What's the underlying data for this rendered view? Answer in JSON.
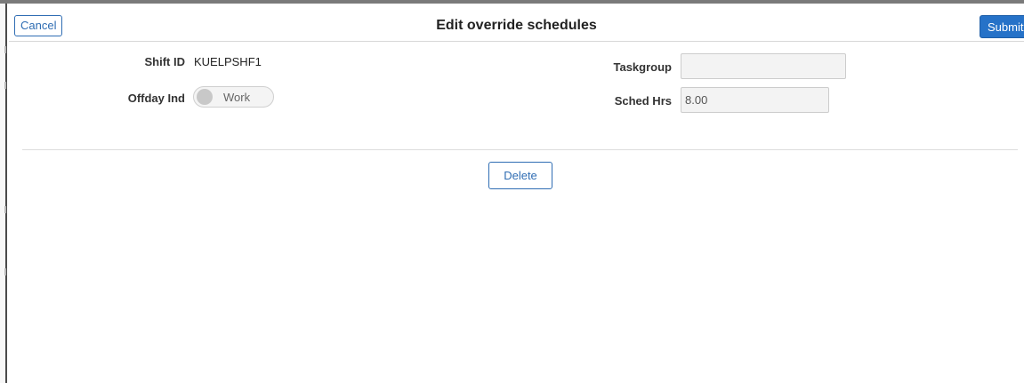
{
  "header": {
    "title": "Edit override schedules",
    "cancel_label": "Cancel",
    "submit_label": "Submit"
  },
  "form": {
    "shift_id_label": "Shift ID",
    "shift_id_value": "KUELPSHF1",
    "offday_label": "Offday Ind",
    "offday_toggle_label": "Work",
    "offday_toggle_on": false,
    "taskgroup_label": "Taskgroup",
    "taskgroup_value": "",
    "sched_hrs_label": "Sched Hrs",
    "sched_hrs_value": "8.00"
  },
  "actions": {
    "delete_label": "Delete"
  },
  "colors": {
    "accent": "#2672c8",
    "outline_button": "#2f6db3",
    "field_background": "#f3f3f3"
  }
}
